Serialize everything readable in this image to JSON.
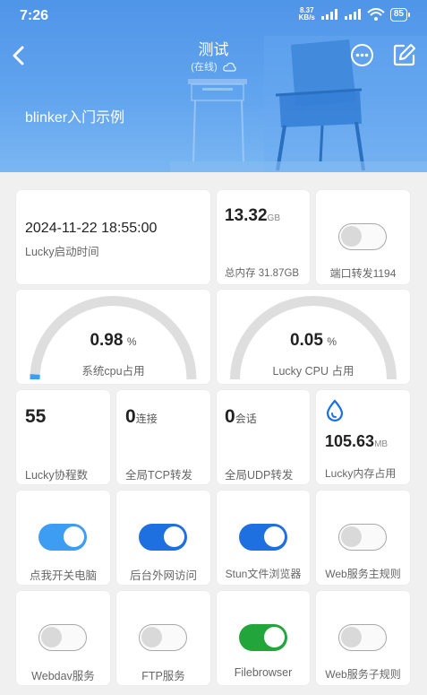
{
  "status_bar": {
    "time": "7:26",
    "net_speed_value": "8.37",
    "net_speed_unit": "KB/s",
    "battery": "85"
  },
  "header": {
    "title": "测试",
    "subtitle": "(在线)",
    "device_name": "blinker入门示例",
    "icons": [
      "back-icon",
      "cloud-icon",
      "more-icon",
      "edit-icon"
    ]
  },
  "start_time": {
    "value": "2024-11-22 18:55:00",
    "label": "Lucky启动时间"
  },
  "memory": {
    "value": "13.32",
    "unit": "GB",
    "label": "总内存 31.87GB"
  },
  "port_forward": {
    "label": "端口转发1194",
    "on": false
  },
  "cpu_sys": {
    "value": "0.98",
    "unit": "%",
    "label": "系统cpu占用",
    "percent": 0.98
  },
  "cpu_lucky": {
    "value": "0.05",
    "unit": "%",
    "label": "Lucky CPU 占用",
    "percent": 0.05
  },
  "goroutines": {
    "value": "55",
    "label": "Lucky协程数"
  },
  "tcp": {
    "value": "0",
    "unit": "连接",
    "label": "全局TCP转发"
  },
  "udp": {
    "value": "0",
    "unit": "会话",
    "label": "全局UDP转发"
  },
  "lucky_mem": {
    "value": "105.63",
    "unit": "MB",
    "label": "Lucky内存占用"
  },
  "toggles": [
    {
      "label": "点我开关电脑",
      "on": true,
      "color": "#3d9df2"
    },
    {
      "label": "后台外网访问",
      "on": true,
      "color": "#1e6fe0"
    },
    {
      "label": "Stun文件浏览器",
      "on": true,
      "color": "#1e6fe0"
    },
    {
      "label": "Web服务主规则",
      "on": false,
      "color": ""
    },
    {
      "label": "Webdav服务",
      "on": false,
      "color": ""
    },
    {
      "label": "FTP服务",
      "on": false,
      "color": ""
    },
    {
      "label": "Filebrowser",
      "on": true,
      "color": "#22a63b"
    },
    {
      "label": "Web服务子规则",
      "on": false,
      "color": ""
    }
  ],
  "colors": {
    "gauge_track": "#dedede",
    "gauge_fill": "#3d9df2",
    "accent": "#1e6fe0"
  }
}
